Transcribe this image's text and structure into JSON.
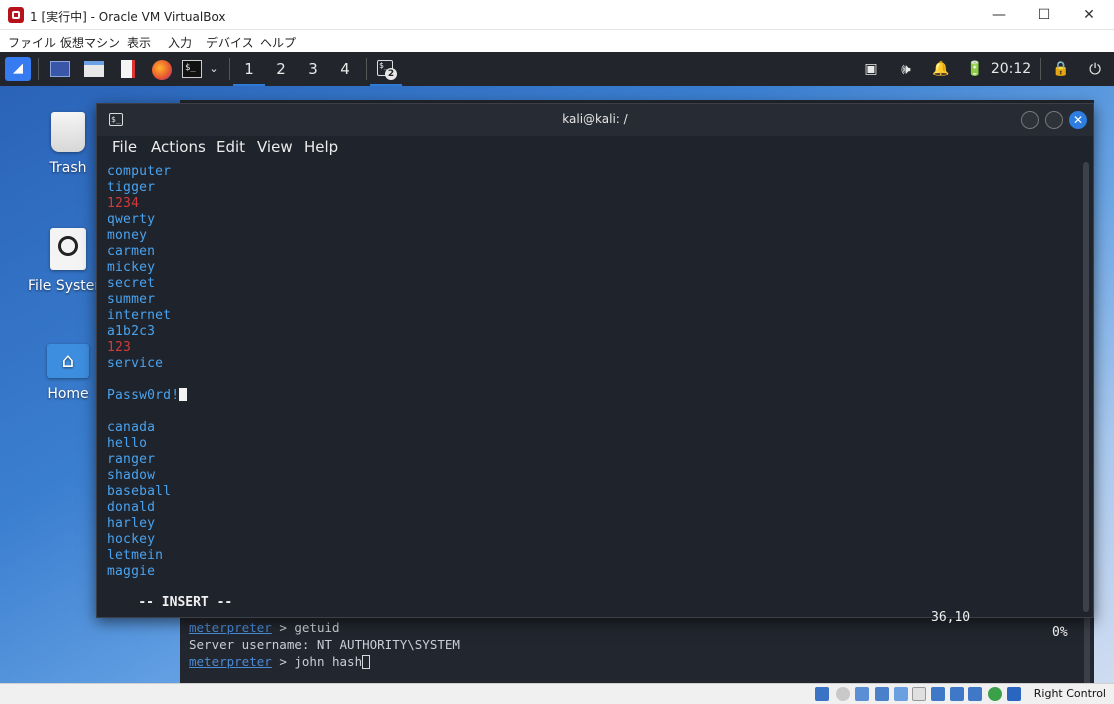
{
  "host": {
    "title": "1 [実行中] - Oracle VM VirtualBox",
    "menu": [
      "ファイル",
      "仮想マシン",
      "表示",
      "入力",
      "デバイス",
      "ヘルプ"
    ],
    "status_right": "Right Control"
  },
  "panel": {
    "workspaces": [
      "1",
      "2",
      "3",
      "4"
    ],
    "terminal_badge": "2",
    "clock": "20:12"
  },
  "desktop": {
    "icons": [
      {
        "label": "Trash"
      },
      {
        "label": "File System"
      },
      {
        "label": "Home"
      }
    ]
  },
  "terminal": {
    "title": "kali@kali: /",
    "menu": [
      "File",
      "Actions",
      "Edit",
      "View",
      "Help"
    ],
    "words": [
      {
        "text": "computer",
        "red": false
      },
      {
        "text": "tigger",
        "red": false
      },
      {
        "text": "1234",
        "red": true
      },
      {
        "text": "qwerty",
        "red": false
      },
      {
        "text": "money",
        "red": false
      },
      {
        "text": "carmen",
        "red": false
      },
      {
        "text": "mickey",
        "red": false
      },
      {
        "text": "secret",
        "red": false
      },
      {
        "text": "summer",
        "red": false
      },
      {
        "text": "internet",
        "red": false
      },
      {
        "text": "a1b2c3",
        "red": false
      },
      {
        "text": "123",
        "red": true
      },
      {
        "text": "service",
        "red": false
      },
      {
        "text": "",
        "red": false
      },
      {
        "text": "Passw0rd!",
        "red": false
      },
      {
        "text": "",
        "red": false
      },
      {
        "text": "canada",
        "red": false
      },
      {
        "text": "hello",
        "red": false
      },
      {
        "text": "ranger",
        "red": false
      },
      {
        "text": "shadow",
        "red": false
      },
      {
        "text": "baseball",
        "red": false
      },
      {
        "text": "donald",
        "red": false
      },
      {
        "text": "harley",
        "red": false
      },
      {
        "text": "hockey",
        "red": false
      },
      {
        "text": "letmein",
        "red": false
      },
      {
        "text": "maggie",
        "red": false
      }
    ],
    "status_mode": "-- INSERT --",
    "status_pos": "36,10",
    "status_pct": "0%"
  },
  "bg_terminal": {
    "lines_bottom": [
      {
        "prompt": "meterpreter",
        "rest": " > getuid"
      },
      {
        "prompt": "",
        "rest": "Server username: NT AUTHORITY\\SYSTEM"
      },
      {
        "prompt": "meterpreter",
        "rest": " > john hash"
      }
    ]
  }
}
